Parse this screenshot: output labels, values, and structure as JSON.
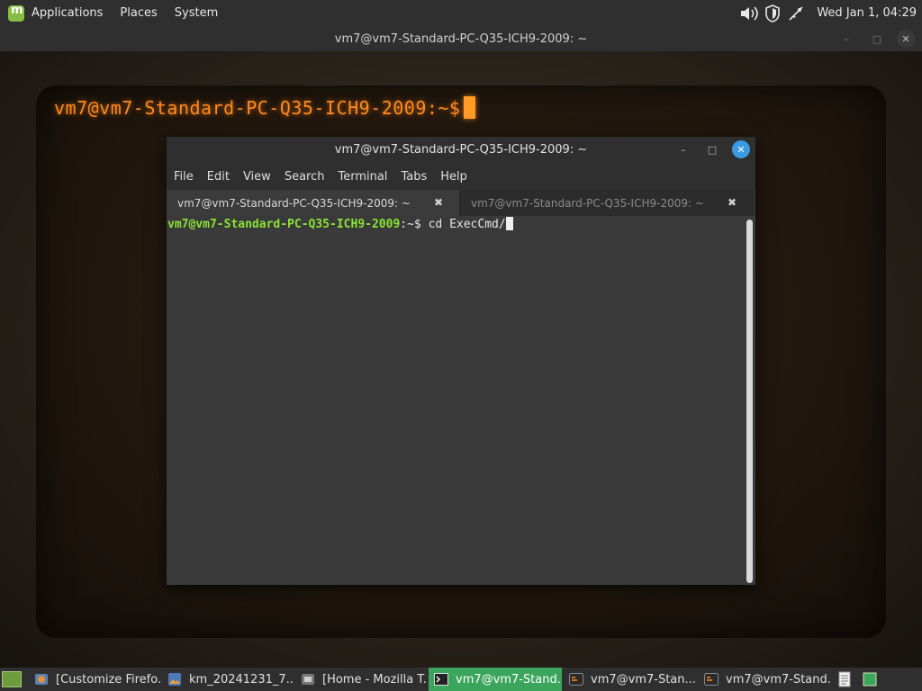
{
  "top_panel": {
    "menus": [
      "Applications",
      "Places",
      "System"
    ],
    "clock": "Wed Jan  1, 04:29"
  },
  "outer_window": {
    "title": "vm7@vm7-Standard-PC-Q35-ICH9-2009: ~",
    "crt_prompt": "vm7@vm7-Standard-PC-Q35-ICH9-2009:~$"
  },
  "terminal": {
    "title": "vm7@vm7-Standard-PC-Q35-ICH9-2009: ~",
    "menus": [
      "File",
      "Edit",
      "View",
      "Search",
      "Terminal",
      "Tabs",
      "Help"
    ],
    "tabs": [
      {
        "label": "vm7@vm7-Standard-PC-Q35-ICH9-2009: ~"
      },
      {
        "label": "vm7@vm7-Standard-PC-Q35-ICH9-2009: ~"
      }
    ],
    "prompt_user": "vm7@vm7-Standard-PC-Q35-ICH9-2009",
    "prompt_path": ":~$ ",
    "command": "cd ExecCmd/"
  },
  "taskbar": {
    "tasks": [
      {
        "label": "[Customize Firefo...",
        "icon": "firefox-icon"
      },
      {
        "label": "km_20241231_7...",
        "icon": "image-viewer-icon"
      },
      {
        "label": "[Home - Mozilla T...",
        "icon": "thunderbird-icon"
      },
      {
        "label": "vm7@vm7-Stand...",
        "icon": "terminal-icon"
      },
      {
        "label": "vm7@vm7-Stan...",
        "icon": "cool-retro-term-icon"
      },
      {
        "label": "vm7@vm7-Stand...",
        "icon": "cool-retro-term-icon"
      }
    ]
  },
  "colors": {
    "prompt_green": "#8ae234",
    "crt_amber": "#ff8a1e",
    "active_task": "#3ba55c",
    "close_button": "#3b9ae2"
  }
}
